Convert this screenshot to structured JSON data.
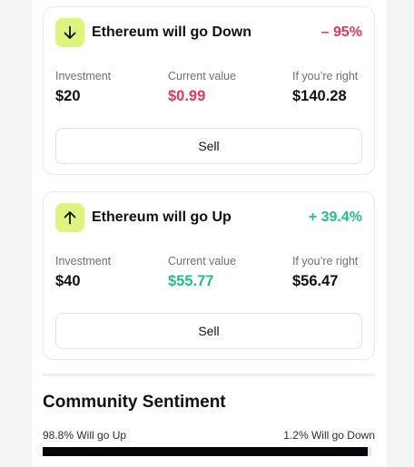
{
  "positions": [
    {
      "title": "Ethereum will go Down",
      "direction": "down",
      "direction_icon": "arrow-down-icon",
      "change": "– 95%",
      "change_color": "#f0305e",
      "investment_label": "Investment",
      "investment_value": "$20",
      "current_label": "Current value",
      "current_value": "$0.99",
      "current_color": "#f0305e",
      "right_label": "If you’re right",
      "right_value": "$140.28",
      "sell_label": "Sell"
    },
    {
      "title": "Ethereum will go Up",
      "direction": "up",
      "direction_icon": "arrow-up-icon",
      "change": "+ 39.4%",
      "change_color": "#1fc08e",
      "investment_label": "Investment",
      "investment_value": "$40",
      "current_label": "Current value",
      "current_value": "$55.77",
      "current_color": "#1fc08e",
      "right_label": "If you’re right",
      "right_value": "$56.47",
      "sell_label": "Sell"
    }
  ],
  "sentiment": {
    "title": "Community Sentiment",
    "up_label": "98.8% Will go Up",
    "down_label": "1.2% Will go Down",
    "up_fraction": 0.988
  },
  "colors": {
    "icon_bg": "#dcf57a",
    "negative": "#f0305e",
    "positive": "#1fc08e",
    "bar_fill": "#05070b"
  }
}
